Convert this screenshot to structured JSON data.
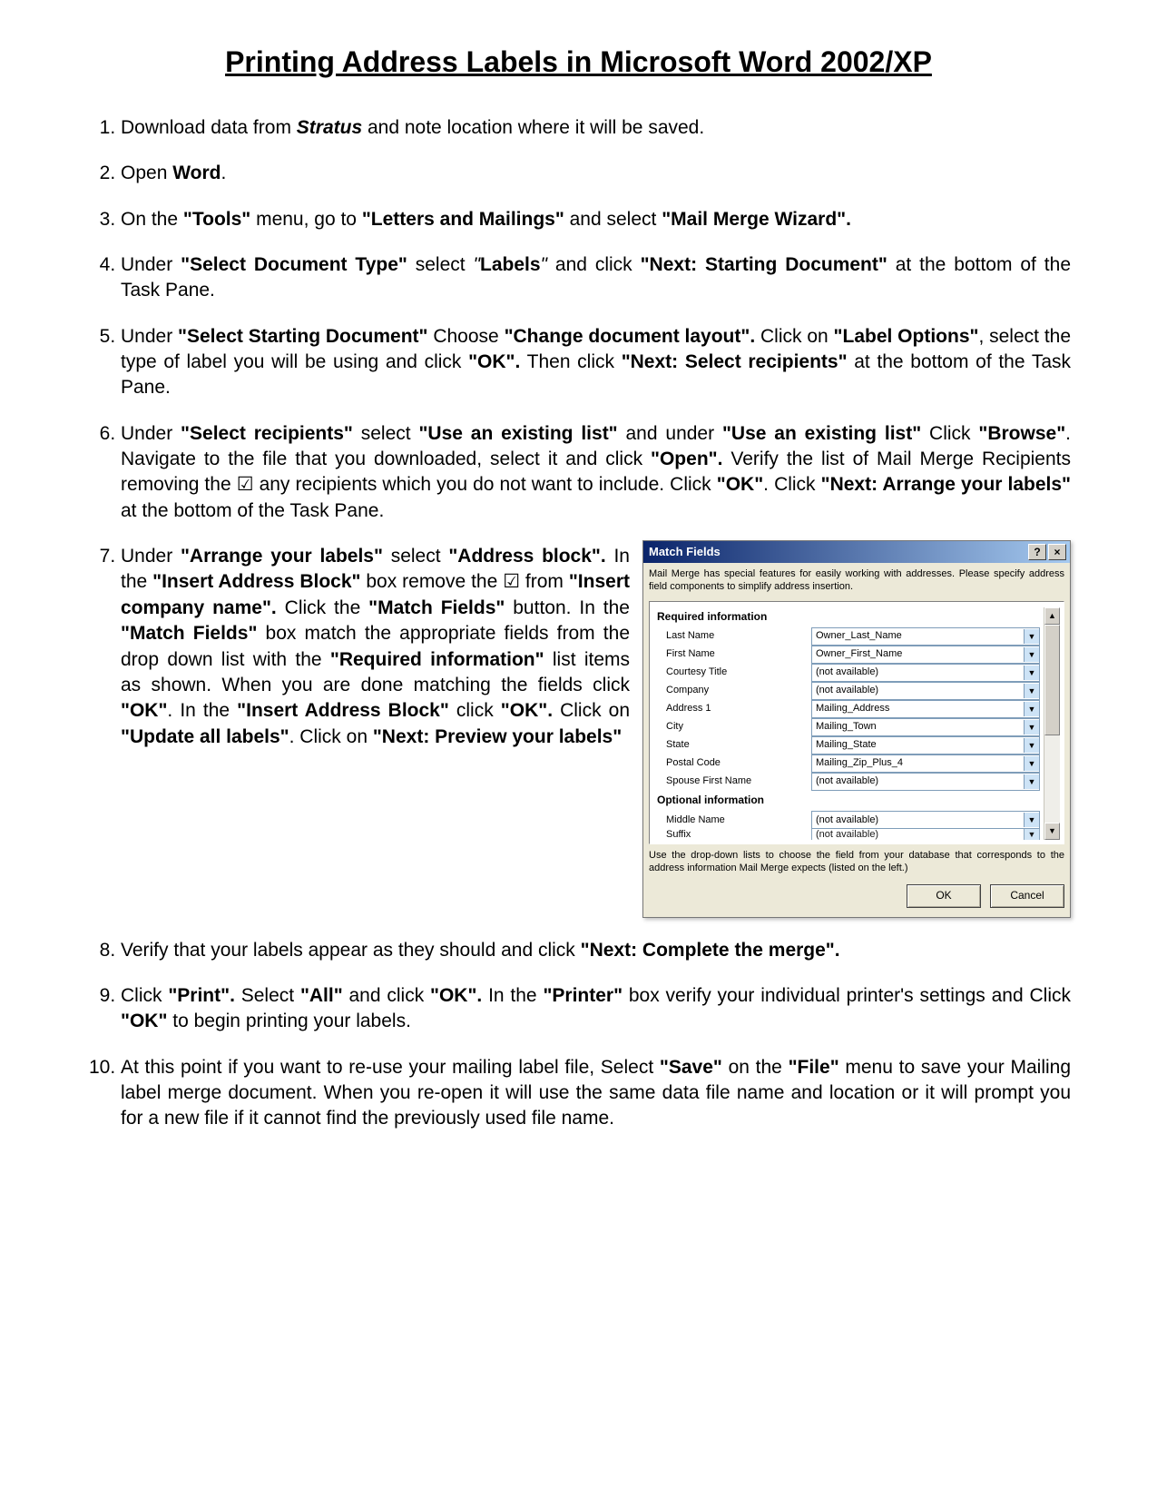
{
  "title": "Printing Address Labels in Microsoft Word 2002/XP",
  "steps": {
    "s1_a": "Download data from ",
    "s1_b": "Stratus",
    "s1_c": " and note location where it will be saved.",
    "s2_a": "Open ",
    "s2_b": "Word",
    "s2_c": ".",
    "s3_a": "On the ",
    "s3_b": "\"Tools\"",
    "s3_c": " menu, go to ",
    "s3_d": "\"Letters and Mailings\"",
    "s3_e": " and select ",
    "s3_f": "\"Mail Merge Wizard\".",
    "s4_a": "Under ",
    "s4_b": "\"Select Document Type\"",
    "s4_c": " select ",
    "s4_d": "\"",
    "s4_e": "Labels",
    "s4_f": "\"",
    "s4_g": " and click ",
    "s4_h": "\"Next: Starting Document\"",
    "s4_i": " at the bottom of the Task Pane.",
    "s5_a": "Under ",
    "s5_b": "\"Select Starting Document\"",
    "s5_c": " Choose ",
    "s5_d": "\"Change document layout\".",
    "s5_e": " Click on ",
    "s5_f": "\"Label Options\"",
    "s5_g": ", select the type of label you will be using and click ",
    "s5_h": "\"OK\".",
    "s5_i": " Then click ",
    "s5_j": "\"Next: Select recipients\"",
    "s5_k": " at the bottom of the Task Pane.",
    "s6_a": "Under ",
    "s6_b": "\"Select recipients\"",
    "s6_c": " select ",
    "s6_d": "\"Use an existing list\"",
    "s6_e": " and under ",
    "s6_f": "\"Use an existing list\"",
    "s6_g": " Click ",
    "s6_h": "\"Browse\"",
    "s6_i": ". Navigate to the file that you downloaded, select it and click ",
    "s6_j": "\"Open\".",
    "s6_k": " Verify the list of Mail Merge Recipients removing the ",
    "s6_l": "☑",
    "s6_m": " any recipients which you do not want to include. Click ",
    "s6_n": "\"OK\"",
    "s6_o": ". Click ",
    "s6_p": "\"Next: Arrange your labels\"",
    "s6_q": " at the bottom of the Task Pane.",
    "s7_a": "Under ",
    "s7_b": "\"Arrange your labels\"",
    "s7_c": " select ",
    "s7_d": "\"Address block\".",
    "s7_e": " In the ",
    "s7_f": "\"Insert Address Block\"",
    "s7_g": " box remove the ",
    "s7_h": "☑",
    "s7_i": " from ",
    "s7_j": "\"Insert company name\".",
    "s7_k": " Click the ",
    "s7_l": "\"Match Fields\"",
    "s7_m": " button. In the ",
    "s7_n": "\"Match Fields\"",
    "s7_o": " box match the appropriate fields from the drop down list with the ",
    "s7_p": "\"Required information\"",
    "s7_q": " list items as shown. When you are done matching the fields click ",
    "s7_r": "\"OK\"",
    "s7_s": ". In the ",
    "s7_t": "\"Insert Address Block\"",
    "s7_u": " click ",
    "s7_v": "\"OK\".",
    "s7_w": " Click on ",
    "s7_x": "\"Update all labels\"",
    "s7_y": ". Click on ",
    "s7_z": "\"Next: Preview your labels\"",
    "s8_a": "Verify that your labels appear as they should and click ",
    "s8_b": "\"Next: Complete the merge\".",
    "s9_a": "Click ",
    "s9_b": "\"Print\".",
    "s9_c": " Select ",
    "s9_d": "\"All\"",
    "s9_e": " and click ",
    "s9_f": "\"OK\".",
    "s9_g": " In the ",
    "s9_h": "\"Printer\"",
    "s9_i": " box verify your individual printer's settings and Click ",
    "s9_j": "\"OK\"",
    "s9_k": " to begin printing your labels.",
    "s10_a": "At this point if you want to re-use your mailing label file, Select ",
    "s10_b": "\"Save\"",
    "s10_c": " on the ",
    "s10_d": "\"File\"",
    "s10_e": " menu to save your Mailing label merge document. When you re-open it will use the same data file name and location or it will prompt you for a new file if it cannot find the previously used file name."
  },
  "dialog": {
    "title": "Match Fields",
    "help": "?",
    "close": "×",
    "instr": "Mail Merge has special features for easily working with addresses. Please specify address field components to simplify address insertion.",
    "required_head": "Required information",
    "optional_head": "Optional information",
    "rows": [
      {
        "label": "Last Name",
        "value": "Owner_Last_Name"
      },
      {
        "label": "First Name",
        "value": "Owner_First_Name"
      },
      {
        "label": "Courtesy Title",
        "value": "(not available)"
      },
      {
        "label": "Company",
        "value": "(not available)"
      },
      {
        "label": "Address 1",
        "value": "Mailing_Address"
      },
      {
        "label": "City",
        "value": "Mailing_Town"
      },
      {
        "label": "State",
        "value": "Mailing_State"
      },
      {
        "label": "Postal Code",
        "value": "Mailing_Zip_Plus_4"
      },
      {
        "label": "Spouse First Name",
        "value": "(not available)"
      }
    ],
    "opt_rows": [
      {
        "label": "Middle Name",
        "value": "(not available)"
      },
      {
        "label": "Suffix",
        "value": "(not available)"
      }
    ],
    "footnote": "Use the drop-down lists to choose the field from your database that corresponds to the address information Mail Merge expects (listed on the left.)",
    "ok": "OK",
    "cancel": "Cancel"
  }
}
